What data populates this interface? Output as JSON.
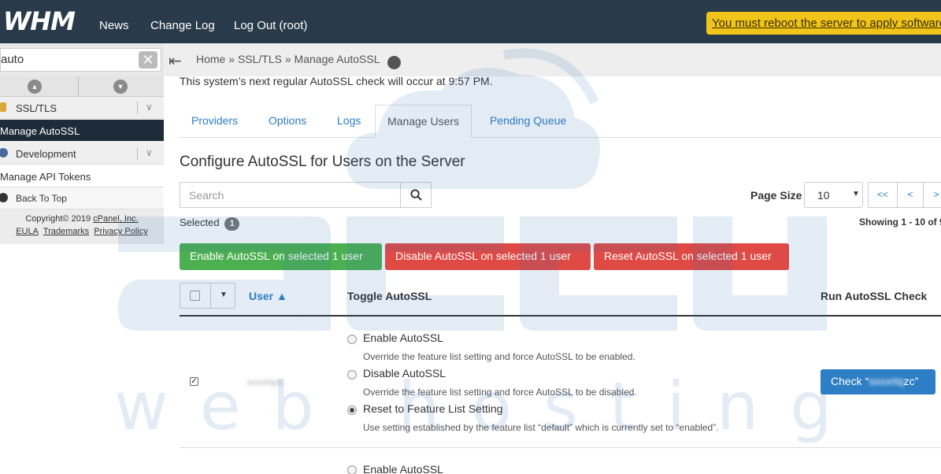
{
  "topbar": {
    "logo": "WHM",
    "nav": [
      "News",
      "Change Log",
      "Log Out (root)"
    ],
    "reboot_notice": "You must reboot the server to apply software"
  },
  "sidebar": {
    "search_value": "auto",
    "items": [
      {
        "label": "SSL/TLS",
        "type": "category"
      },
      {
        "label": "Manage AutoSSL",
        "type": "active"
      },
      {
        "label": "Development",
        "type": "category"
      },
      {
        "label": "Manage API Tokens",
        "type": "item"
      },
      {
        "label": "Back To Top",
        "type": "sub"
      }
    ],
    "footer": {
      "copyright": "Copyright© 2019",
      "company": "cPanel, Inc.",
      "links": [
        "EULA",
        "Trademarks",
        "Privacy Policy"
      ]
    }
  },
  "breadcrumb": {
    "home": "Home",
    "section": "SSL/TLS",
    "page": "Manage AutoSSL",
    "separator": "»"
  },
  "main": {
    "next_check": "This system’s next regular AutoSSL check will occur at 9:57 PM.",
    "tabs": [
      {
        "label": "Providers",
        "active": false
      },
      {
        "label": "Options",
        "active": false
      },
      {
        "label": "Logs",
        "active": false
      },
      {
        "label": "Manage Users",
        "active": true
      },
      {
        "label": "Pending Queue",
        "active": false
      }
    ],
    "section_title": "Configure AutoSSL for Users on the Server",
    "search_placeholder": "Search",
    "page_size_label": "Page Size",
    "page_size_value": "10",
    "pager": [
      "<<",
      "<",
      ">"
    ],
    "selected_label": "Selected",
    "selected_count": "1",
    "showing": "Showing 1 - 10 of 9",
    "actions": {
      "enable": "Enable AutoSSL on selected 1 user",
      "disable": "Disable AutoSSL on selected 1 user",
      "reset": "Reset AutoSSL on selected 1 user"
    },
    "table": {
      "col_user": "User",
      "col_user_sort": "▲",
      "col_toggle": "Toggle AutoSSL",
      "col_run": "Run AutoSSL Check",
      "rows": [
        {
          "checked": true,
          "username": "sxxxrtqzc",
          "options": [
            {
              "label": "Enable AutoSSL",
              "desc": "Override the feature list setting and force AutoSSL to be enabled.",
              "selected": false
            },
            {
              "label": "Disable AutoSSL",
              "desc": "Override the feature list setting and force AutoSSL to be disabled.",
              "selected": false
            },
            {
              "label": "Reset to Feature List Setting",
              "desc": "Use setting established by the feature list “default” which is currently set to “enabled”.",
              "selected": true
            }
          ],
          "check_prefix": "Check “",
          "check_user": "sxxxrtq",
          "check_suffix": "zc”"
        }
      ],
      "next_row_first_option": "Enable AutoSSL"
    }
  },
  "colors": {
    "topbar": "#293a4a",
    "link": "#2d7ec4",
    "green": "#4cb050",
    "red": "#e04a45",
    "notice": "#f0c419",
    "watermark": "#2d6fb2"
  },
  "watermark": {
    "brand": "accu",
    "tagline": "web hosting"
  }
}
